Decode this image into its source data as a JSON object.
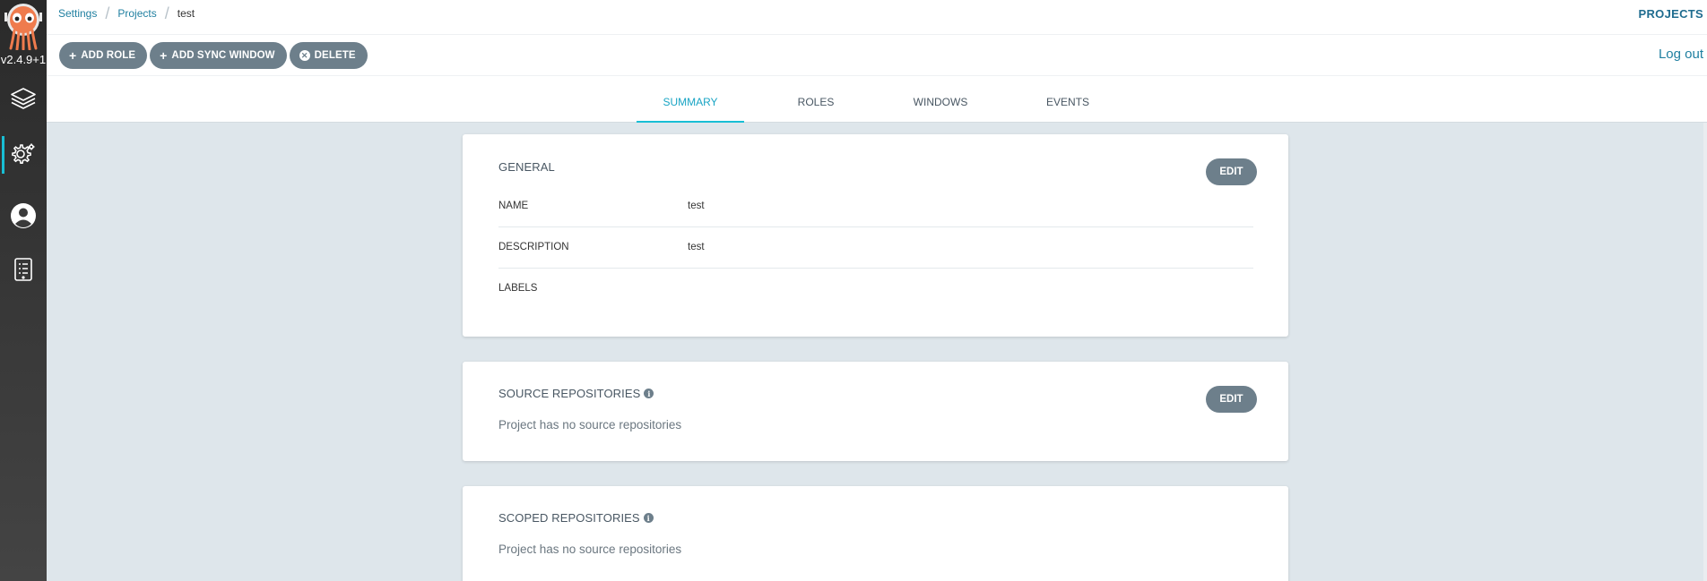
{
  "sidebar": {
    "version": "v2.4.9+1",
    "nav": [
      {
        "name": "applications",
        "icon": "layers-icon"
      },
      {
        "name": "settings",
        "icon": "gears-icon",
        "active": true
      },
      {
        "name": "user-info",
        "icon": "user-circle-icon"
      },
      {
        "name": "documentation",
        "icon": "docs-icon"
      }
    ]
  },
  "breadcrumb": {
    "items": [
      "Settings",
      "Projects"
    ],
    "current": "test"
  },
  "page_type": "PROJECTS",
  "toolbar": {
    "add_role": "ADD ROLE",
    "add_sync_window": "ADD SYNC WINDOW",
    "delete": "DELETE",
    "logout": "Log out"
  },
  "tabs": [
    "SUMMARY",
    "ROLES",
    "WINDOWS",
    "EVENTS"
  ],
  "general": {
    "title": "GENERAL",
    "edit": "EDIT",
    "fields": [
      {
        "label": "NAME",
        "value": "test"
      },
      {
        "label": "DESCRIPTION",
        "value": "test"
      },
      {
        "label": "LABELS",
        "value": ""
      }
    ]
  },
  "source_repos": {
    "title": "SOURCE REPOSITORIES",
    "edit": "EDIT",
    "empty": "Project has no source repositories"
  },
  "scoped_repos": {
    "title": "SCOPED REPOSITORIES",
    "empty": "Project has no source repositories"
  },
  "colors": {
    "accent": "#18bed4",
    "link": "#1f7fa0",
    "button": "#6d7f8b",
    "background": "#dee6eb"
  }
}
